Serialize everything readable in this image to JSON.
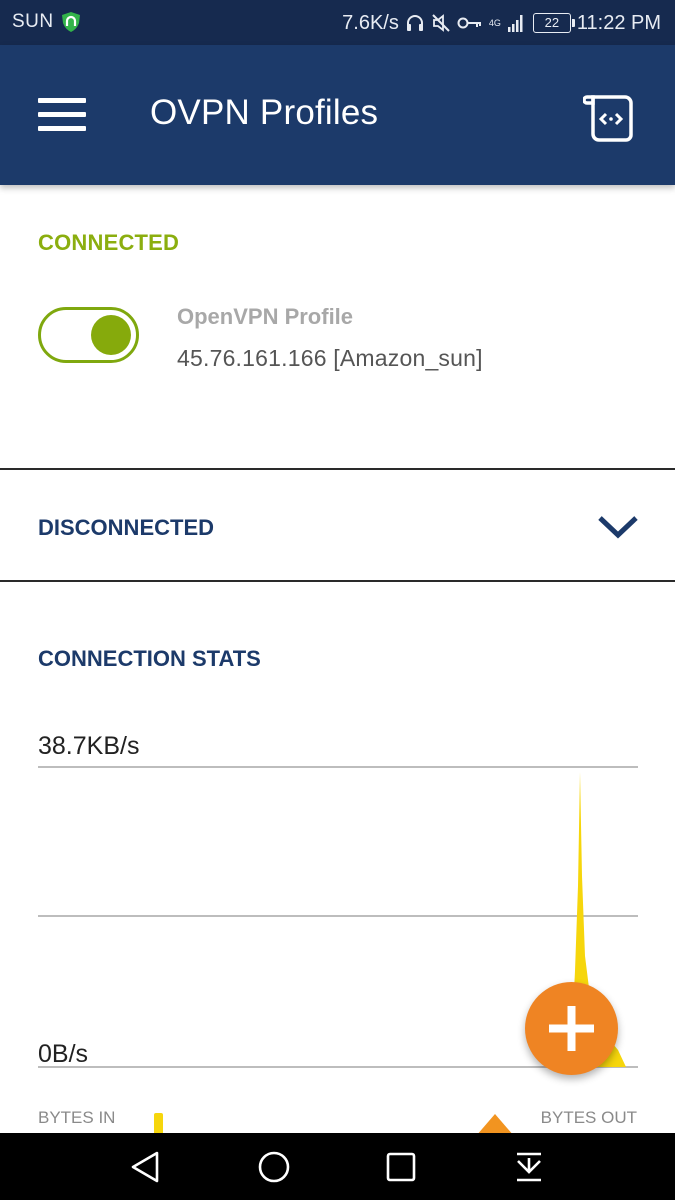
{
  "status_bar": {
    "carrier": "SUN",
    "net_speed": "7.6K/s",
    "network_type": "4G",
    "battery": "22",
    "time": "11:22 PM",
    "icons": [
      "vpn-shield-icon",
      "headset-icon",
      "mute-icon",
      "vpn-key-icon",
      "signal-icon",
      "battery-icon"
    ]
  },
  "app_bar": {
    "title": "OVPN Profiles",
    "menu_icon": "hamburger-menu-icon",
    "log_icon": "log-scroll-icon"
  },
  "connected": {
    "label": "CONNECTED",
    "toggle_on": true,
    "profile_name": "OpenVPN Profile",
    "server": "45.76.161.166 [Amazon_sun]"
  },
  "disconnected": {
    "label": "DISCONNECTED",
    "expand_icon": "chevron-down-icon"
  },
  "stats": {
    "title": "CONNECTION STATS",
    "max_label": "38.7KB/s",
    "min_label": "0B/s",
    "bytes_in_label": "BYTES IN",
    "bytes_out_label": "BYTES OUT"
  },
  "fab": {
    "icon": "plus-icon"
  },
  "nav_bar": {
    "icons": [
      "back-icon",
      "home-icon",
      "recents-icon",
      "notification-pull-icon"
    ]
  },
  "colors": {
    "status_bar": "#162a4f",
    "app_bar": "#1c3a6a",
    "connected_green": "#8bae0f",
    "section_navy": "#1c3a6a",
    "fab_orange": "#ef8423",
    "bytes_in_yellow": "#f6d60c",
    "bytes_out_orange": "#f29420"
  }
}
